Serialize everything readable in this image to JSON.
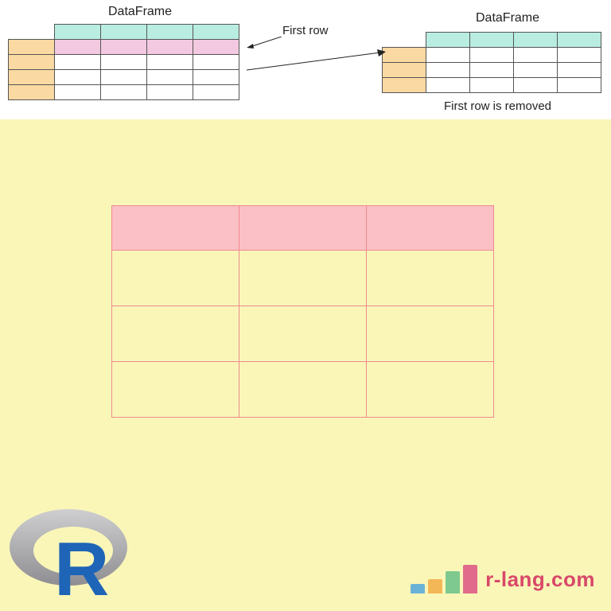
{
  "labels": {
    "dataframe": "DataFrame",
    "first_row": "First row",
    "removed": "First row is removed"
  },
  "brand": {
    "text": "r-lang.com"
  },
  "colors": {
    "bg_yellow": "#f9f6b8",
    "header_teal": "#b9ede1",
    "index_orange": "#fbd9a3",
    "firstrow_pink": "#f3c9e1",
    "center_pink_header": "#fac0c5",
    "center_border": "#ef8a90",
    "brand_text": "#d9486a"
  },
  "left_df": {
    "columns": 4,
    "rows": 4,
    "highlighted_row_index": 0
  },
  "right_df": {
    "columns": 4,
    "rows": 3
  },
  "center_df": {
    "columns": 3,
    "rows": 4
  }
}
